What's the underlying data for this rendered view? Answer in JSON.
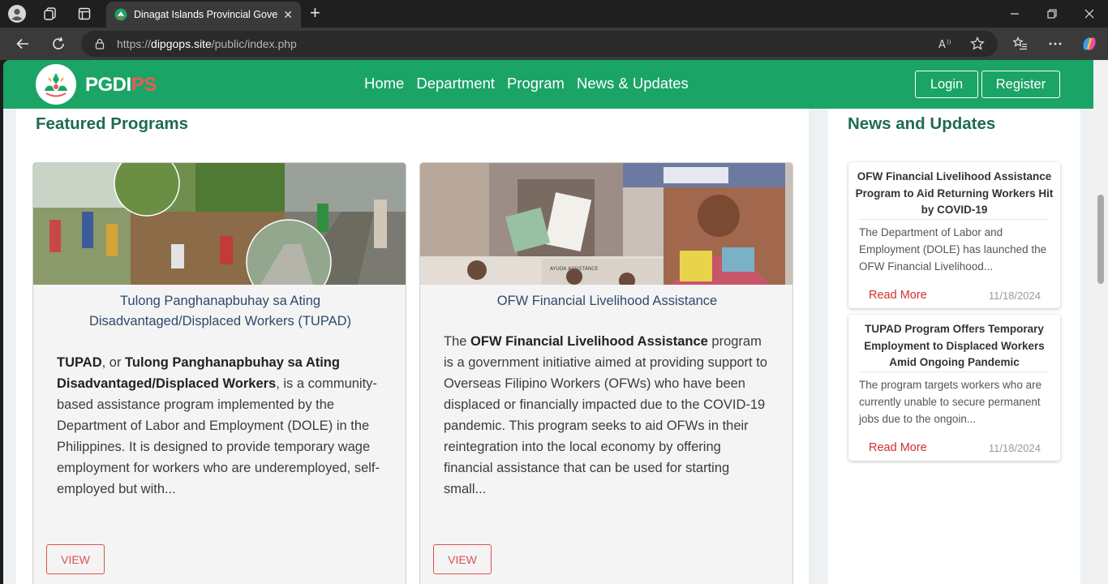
{
  "browser": {
    "tab_title": "Dinagat Islands Provincial Governm",
    "url_prefix": "https://",
    "url_host": "dipgops.site",
    "url_path": "/public/index.php"
  },
  "site": {
    "brand_main": "PGDI",
    "brand_accent": "PS",
    "menu": [
      "Home",
      "Department",
      "Program",
      "News & Updates"
    ],
    "login_label": "Login",
    "register_label": "Register"
  },
  "featured": {
    "heading": "Featured Programs",
    "cards": [
      {
        "title": "Tulong Panghanapbuhay sa Ating Disadvantaged/Displaced Workers (TUPAD)",
        "body_bold1": "TUPAD",
        "body_mid1": ", or ",
        "body_bold2": "Tulong Panghanapbuhay sa Ating Disadvantaged/Displaced Workers",
        "body_rest": ", is a community-based assistance program implemented by the Department of Labor and Employment (DOLE) in the Philippines. It is designed to provide temporary wage employment for workers who are underemployed, self-employed but with...",
        "button": "VIEW"
      },
      {
        "title": "OFW Financial Livelihood Assistance",
        "body_pre": "The ",
        "body_bold": "OFW Financial Livelihood Assistance",
        "body_rest": " program is a government initiative aimed at providing support to Overseas Filipino Workers (OFWs) who have been displaced or financially impacted due to the COVID-19 pandemic. This program seeks to aid OFWs in their reintegration into the local economy by offering financial assistance that can be used for starting small...",
        "button": "VIEW"
      }
    ]
  },
  "news": {
    "heading": "News and Updates",
    "items": [
      {
        "title": "OFW Financial Livelihood Assistance Program to Aid Returning Workers Hit by COVID-19",
        "excerpt": "The Department of Labor and Employment (DOLE) has launched the OFW Financial Livelihood...",
        "read_more": "Read More",
        "date": "11/18/2024"
      },
      {
        "title": "TUPAD Program Offers Temporary Employment to Displaced Workers Amid Ongoing Pandemic",
        "excerpt": "The program targets workers who are currently unable to secure permanent jobs due to the ongoin...",
        "read_more": "Read More",
        "date": "11/18/2024"
      }
    ]
  },
  "colors": {
    "nav_green": "#1aa465",
    "heading_green": "#1f6b52",
    "accent_red": "#d9534f"
  }
}
